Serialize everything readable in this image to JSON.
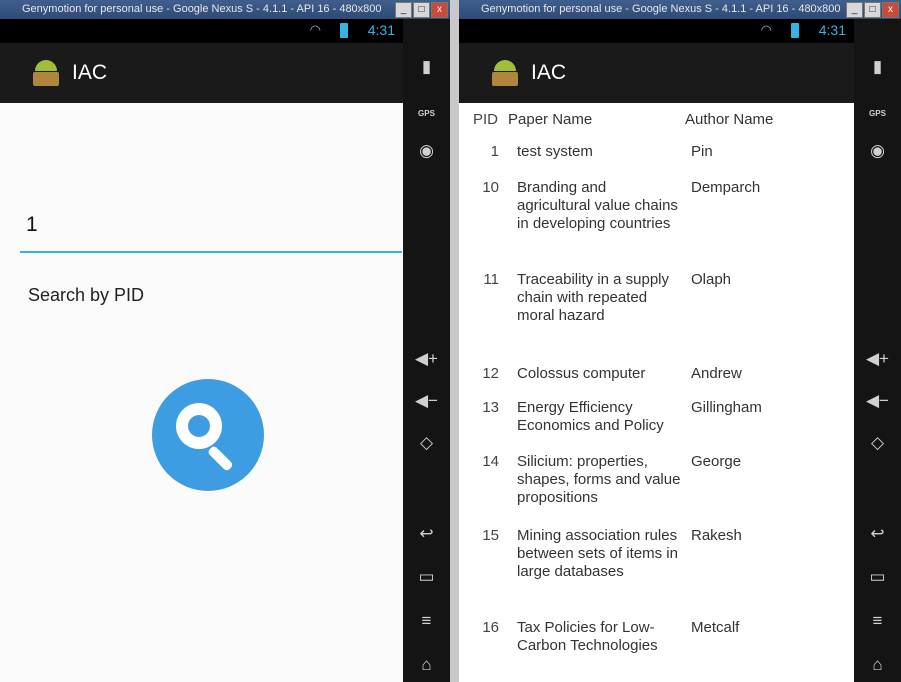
{
  "left_window": {
    "title": "Genymotion for personal use - Google Nexus S - 4.1.1 - API 16 - 480x800",
    "status_time": "4:31",
    "app_title": "IAC",
    "pid_input_value": "1",
    "search_label": "Search by PID",
    "sidebar": {
      "gps_label": "GPS"
    }
  },
  "right_window": {
    "title": "Genymotion for personal use - Google Nexus S - 4.1.1 - API 16 - 480x800",
    "status_time": "4:31",
    "app_title": "IAC",
    "headers": {
      "pid": "PID",
      "paper": "Paper Name",
      "author": "Author Name"
    },
    "rows": [
      {
        "pid": "1",
        "paper": "test system",
        "author": "Pin"
      },
      {
        "pid": "10",
        "paper": "Branding and agricultural value chains in developing countries",
        "author": "Demparch"
      },
      {
        "pid": "11",
        "paper": "Traceability in a supply chain with repeated moral hazard",
        "author": "Olaph"
      },
      {
        "pid": "12",
        "paper": "Colossus computer",
        "author": "Andrew"
      },
      {
        "pid": "13",
        "paper": "Energy Efficiency Economics and Policy",
        "author": "Gillingham"
      },
      {
        "pid": "14",
        "paper": "Silicium: properties, shapes, forms and value propositions",
        "author": "George"
      },
      {
        "pid": "15",
        "paper": "Mining association rules between sets of items in large databases",
        "author": "Rakesh"
      },
      {
        "pid": "16",
        "paper": "Tax Policies for Low-Carbon Technologies",
        "author": "Metcalf"
      }
    ],
    "sidebar": {
      "gps_label": "GPS"
    }
  },
  "window_buttons": {
    "minimize": "_",
    "maximize": "□",
    "close": "x"
  }
}
